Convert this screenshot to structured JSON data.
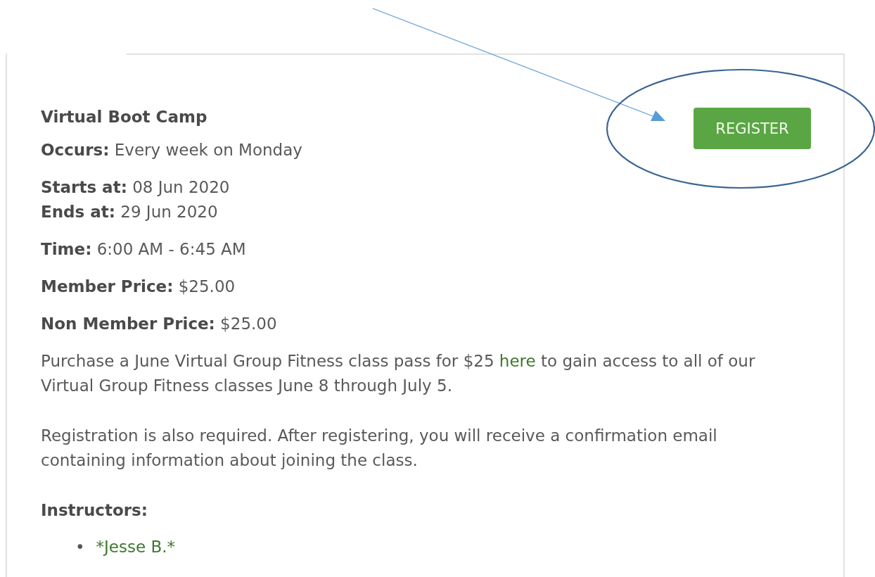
{
  "event": {
    "title": "Virtual Boot Camp",
    "details": [
      {
        "lines": [
          {
            "label": "Occurs:",
            "value": "Every week on Monday"
          }
        ]
      },
      {
        "lines": [
          {
            "label": "Starts at:",
            "value": "08 Jun 2020"
          },
          {
            "label": "Ends at:",
            "value": "29 Jun 2020"
          }
        ]
      },
      {
        "lines": [
          {
            "label": "Time:",
            "value": "6:00 AM - 6:45 AM"
          }
        ]
      },
      {
        "lines": [
          {
            "label": "Member Price:",
            "value": "$25.00"
          }
        ]
      },
      {
        "lines": [
          {
            "label": "Non Member Price:",
            "value": "$25.00"
          }
        ]
      }
    ],
    "register_button": "REGISTER",
    "description": [
      {
        "before": "Purchase a June Virtual Group Fitness class pass for $25",
        "link": "here",
        "after": "to gain access to all of our Virtual Group Fitness classes June 8 through July 5."
      },
      {
        "before": "Registration is also required. After registering, you will receive a confirmation email containing information about joining the class."
      }
    ],
    "instructors_heading": "Instructors:",
    "instructors": [
      {
        "bullet": "•",
        "name": "*Jesse B.*"
      }
    ]
  },
  "annotations": [
    {
      "kind": "arrow"
    },
    {
      "kind": "ellipse"
    }
  ]
}
